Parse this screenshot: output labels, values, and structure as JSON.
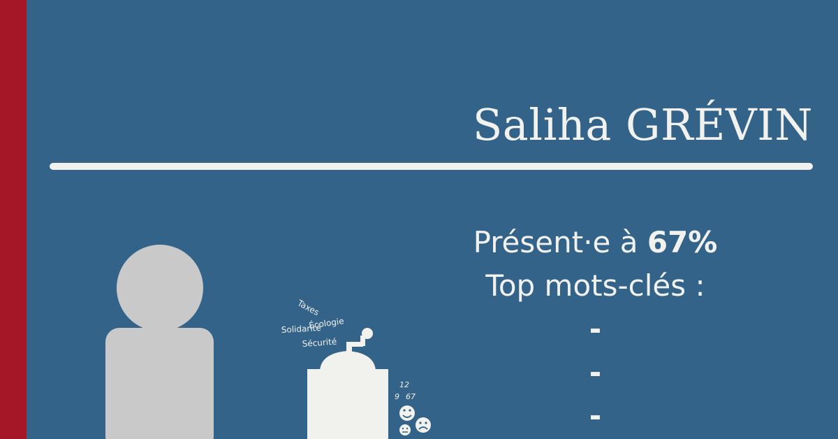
{
  "colors": {
    "background": "#336389",
    "stripe": "#a51626",
    "text": "#f1f1ee",
    "avatar": "#c9c9c9"
  },
  "deputy": {
    "name": "Saliha GRÉVIN"
  },
  "presence": {
    "prefix": "Présent·e à ",
    "value": "67%"
  },
  "keywords": {
    "title": "Top mots-clés :",
    "items": [
      "-",
      "-",
      "-"
    ]
  },
  "illustration": {
    "words": [
      "Taxes",
      "Écologie",
      "Solidarité",
      "Sécurité"
    ],
    "votes": [
      "12",
      "9",
      "67"
    ],
    "icons": [
      "avatar-silhouette-icon",
      "ballot-box-icon",
      "happy-face-icon",
      "sad-face-icon",
      "neutral-face-icon"
    ]
  }
}
